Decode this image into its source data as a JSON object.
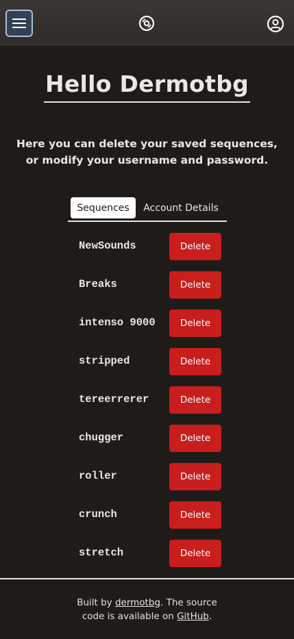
{
  "header": {
    "menu_icon": "hamburger-menu-icon",
    "logo_icon": "vinyl-record-icon",
    "profile_icon": "user-circle-icon"
  },
  "main": {
    "title": "Hello Dermotbg",
    "intro": "Here you can delete your saved sequences, or modify your username and password.",
    "tabs": [
      {
        "label": "Sequences",
        "active": true
      },
      {
        "label": "Account Details",
        "active": false
      }
    ],
    "delete_label": "Delete",
    "sequences": [
      "NewSounds",
      "Breaks",
      "intenso 9000",
      "stripped",
      "tereerrerer",
      "chugger",
      "roller",
      "crunch",
      "stretch"
    ]
  },
  "footer": {
    "text_1": "Built by ",
    "author_link": "dermotbg",
    "text_2": ". The source code is available on ",
    "github_link": "GitHub",
    "text_3": "."
  },
  "colors": {
    "background": "#1f1b18",
    "header": "#33302e",
    "danger": "#c81e1e",
    "text": "#ece7e2"
  }
}
